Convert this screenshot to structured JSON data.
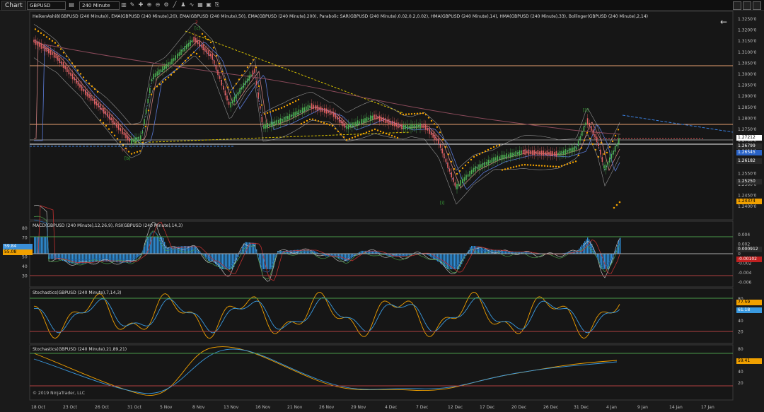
{
  "toolbar": {
    "tab_label": "Chart",
    "instrument": "GBPUSD",
    "interval": "240 Minute"
  },
  "panels": {
    "price": {
      "label": "HeikenAshi8(GBPUSD (240 Minute)), EMA(GBPUSD (240 Minute),20), EMA(GBPUSD (240 Minute),50), EMA(GBPUSD (240 Minute),200), Parabolic SAR(GBPUSD (240 Minute),0.02,0.2,0.02), HMA(GBPUSD (240 Minute),14), HMA(GBPUSD (240 Minute),33), Bollinger(GBPUSD (240 Minute),2,14)",
      "y_ticks": [
        "1.3250'0",
        "1.3200'0",
        "1.3150'0",
        "1.3100'0",
        "1.3050'0",
        "1.3000'0",
        "1.2950'0",
        "1.2900'0",
        "1.2850'0",
        "1.2800'0",
        "1.2750'0",
        "1.2700'0",
        "1.2650'0",
        "1.2600'0",
        "1.2550'0",
        "1.2500'0",
        "1.2450'0",
        "1.2400'0"
      ],
      "tags": [
        {
          "text": "1.27212",
          "color": "#ffffff",
          "fg": "#000000"
        },
        {
          "text": "1.26799",
          "color": "#2a2a2a",
          "fg": "#ffffff"
        },
        {
          "text": "1.26545",
          "color": "#2962c6",
          "fg": "#ffffff"
        },
        {
          "text": "1.26182",
          "color": "#2a2a2a",
          "fg": "#ffffff"
        },
        {
          "text": "1.25250",
          "color": "#2a2a2a",
          "fg": "#ffffff"
        },
        {
          "text": "1.24374",
          "color": "#f0a000",
          "fg": "#000000"
        }
      ],
      "wave_labels": [
        "[c]",
        "(c)",
        "[b]",
        "[ii]",
        "[i]"
      ]
    },
    "macd": {
      "label": "MACD(GBPUSD (240 Minute),12,26,9), RSI(GBPUSD (240 Minute),14,3)",
      "left_ticks": [
        "80",
        "70",
        "60",
        "50",
        "40",
        "30"
      ],
      "right_ticks": [
        "0.004",
        "0.002",
        "0",
        "-0.002",
        "-0.004",
        "-0.006"
      ],
      "left_tags": [
        "59.84",
        "55.08"
      ],
      "right_tags": [
        "0.000912",
        "-0.00102"
      ]
    },
    "stoch1": {
      "label": "Stochastics(GBPUSD (240 Minute),7,14,3)",
      "ticks": [
        "80",
        "60",
        "40",
        "20"
      ],
      "tags": [
        "77.59",
        "61.18"
      ]
    },
    "stoch2": {
      "label": "Stochastics(GBPUSD (240 Minute),21,89,21)",
      "ticks": [
        "80",
        "60",
        "40",
        "20"
      ],
      "tags": [
        "59.41"
      ]
    }
  },
  "x_axis": [
    "18 Oct",
    "23 Oct",
    "26 Oct",
    "31 Oct",
    "5 Nov",
    "8 Nov",
    "13 Nov",
    "16 Nov",
    "21 Nov",
    "26 Nov",
    "29 Nov",
    "4 Dec",
    "7 Dec",
    "12 Dec",
    "17 Dec",
    "20 Dec",
    "26 Dec",
    "31 Dec",
    "4 Jan",
    "9 Jan",
    "14 Jan",
    "17 Jan"
  ],
  "copyright": "© 2019 NinjaTrader, LLC",
  "colors": {
    "background": "#1a1a1a",
    "sar": "#f0a000",
    "bull_candle": "#4caf50",
    "bear_candle": "#e06060",
    "ema200": "#8a4a5a",
    "bollinger": "#c8c8c8",
    "trendline": "#d6c000",
    "macd_hist": "#2f8fd8",
    "stoch_k": "#f0a000",
    "stoch_d": "#3a9ae0"
  }
}
